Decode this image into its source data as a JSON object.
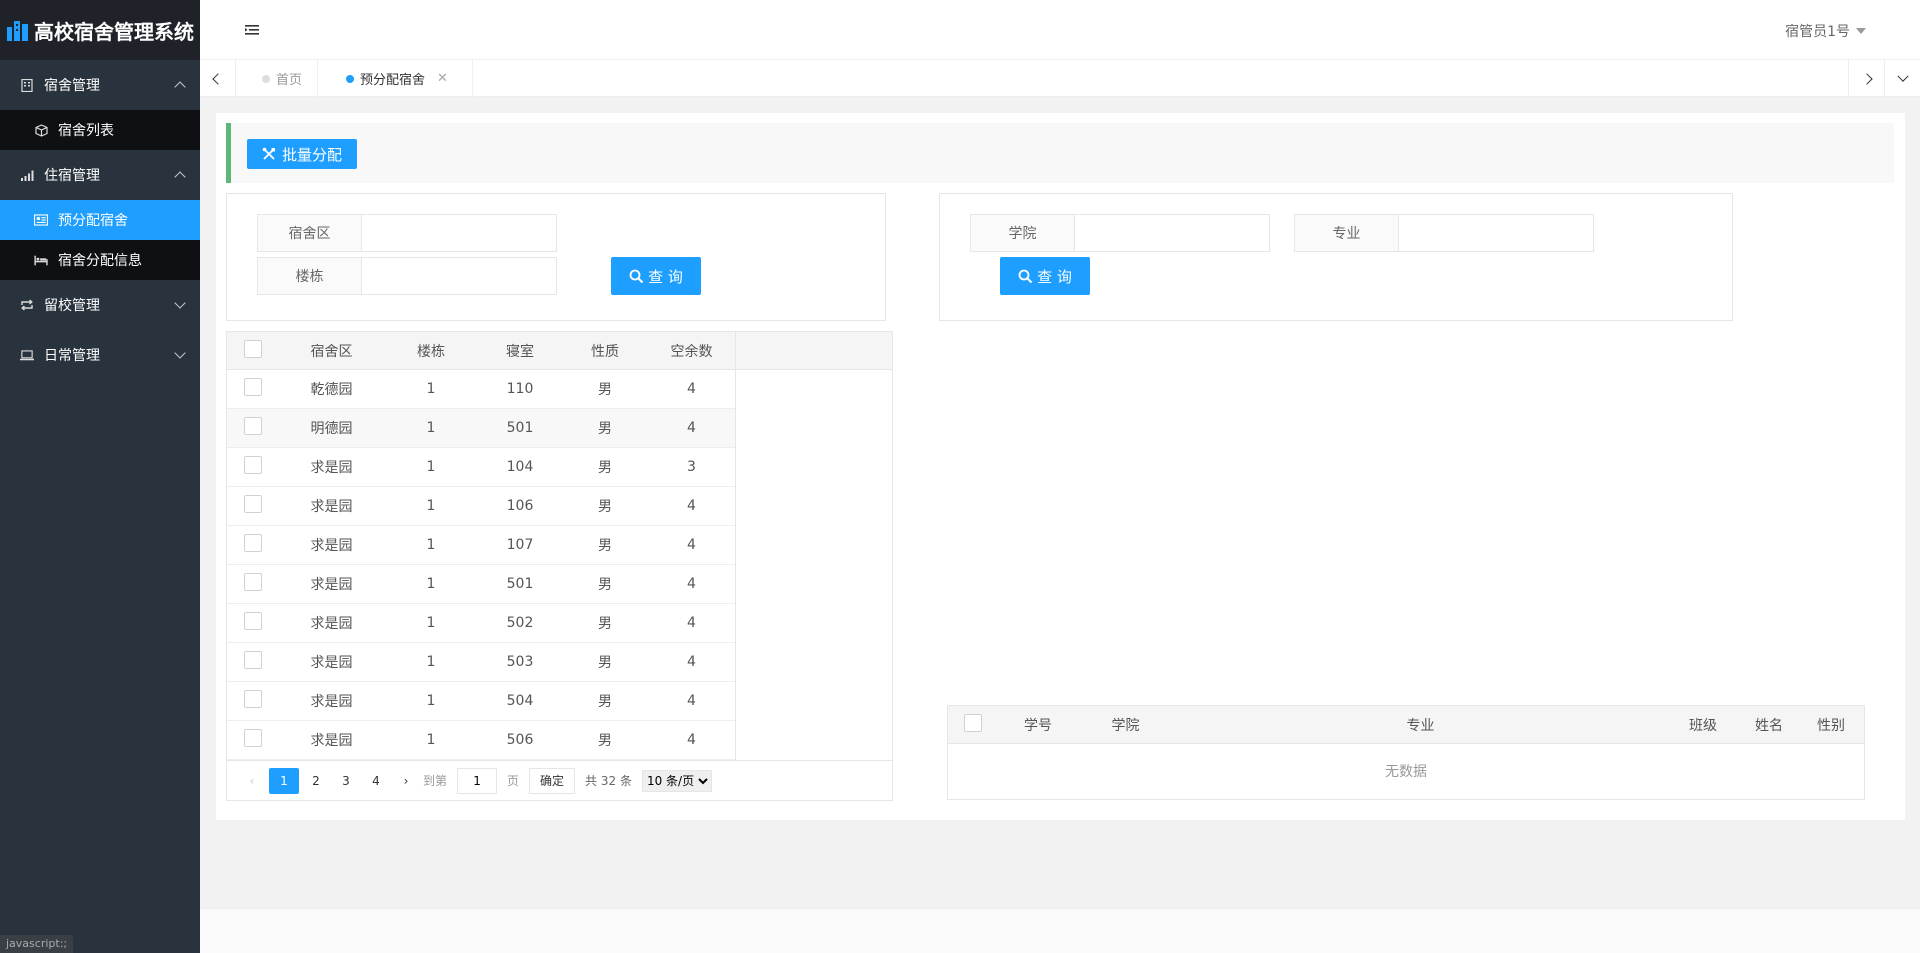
{
  "app": {
    "title": "高校宿舍管理系统"
  },
  "sidebar": {
    "groups": [
      {
        "label": "宿舍管理",
        "icon": "building-icon",
        "expanded": true,
        "items": [
          {
            "label": "宿舍列表",
            "icon": "cube-icon"
          }
        ]
      },
      {
        "label": "住宿管理",
        "icon": "signal-bars-icon",
        "expanded": true,
        "items": [
          {
            "label": "预分配宿舍",
            "icon": "list-card-icon",
            "active": true
          },
          {
            "label": "宿舍分配信息",
            "icon": "bed-icon"
          }
        ]
      },
      {
        "label": "留校管理",
        "icon": "repeat-icon",
        "expanded": false,
        "items": []
      },
      {
        "label": "日常管理",
        "icon": "laptop-icon",
        "expanded": false,
        "items": []
      }
    ]
  },
  "header": {
    "user": "宿管员1号"
  },
  "tabs": [
    {
      "label": "首页",
      "active": false
    },
    {
      "label": "预分配宿舍",
      "active": true
    }
  ],
  "toolbar": {
    "batch_label": "批量分配"
  },
  "left_search": {
    "field1_label": "宿舍区",
    "field2_label": "楼栋",
    "query_label": "查 询"
  },
  "right_search": {
    "field1_label": "学院",
    "field2_label": "专业",
    "query_label": "查 询"
  },
  "dorm_table": {
    "columns": [
      "宿舍区",
      "楼栋",
      "寝室",
      "性质",
      "空余数"
    ],
    "rows": [
      [
        "乾德园",
        "1",
        "110",
        "男",
        "4"
      ],
      [
        "明德园",
        "1",
        "501",
        "男",
        "4"
      ],
      [
        "求是园",
        "1",
        "104",
        "男",
        "3"
      ],
      [
        "求是园",
        "1",
        "106",
        "男",
        "4"
      ],
      [
        "求是园",
        "1",
        "107",
        "男",
        "4"
      ],
      [
        "求是园",
        "1",
        "501",
        "男",
        "4"
      ],
      [
        "求是园",
        "1",
        "502",
        "男",
        "4"
      ],
      [
        "求是园",
        "1",
        "503",
        "男",
        "4"
      ],
      [
        "求是园",
        "1",
        "504",
        "男",
        "4"
      ],
      [
        "求是园",
        "1",
        "506",
        "男",
        "4"
      ]
    ],
    "pager": {
      "pages": [
        "1",
        "2",
        "3",
        "4"
      ],
      "goto_label": "到第",
      "goto_value": "1",
      "page_unit": "页",
      "confirm_label": "确定",
      "total_text": "共 32 条",
      "page_size": "10 条/页"
    }
  },
  "student_table": {
    "columns": [
      "学号",
      "学院",
      "专业",
      "班级",
      "姓名",
      "性别"
    ],
    "empty_text": "无数据"
  },
  "status": {
    "text": "javascript:;"
  },
  "colors": {
    "accent": "#1e9fff",
    "sidebar": "#28333e",
    "green_bar": "#5fb878"
  }
}
